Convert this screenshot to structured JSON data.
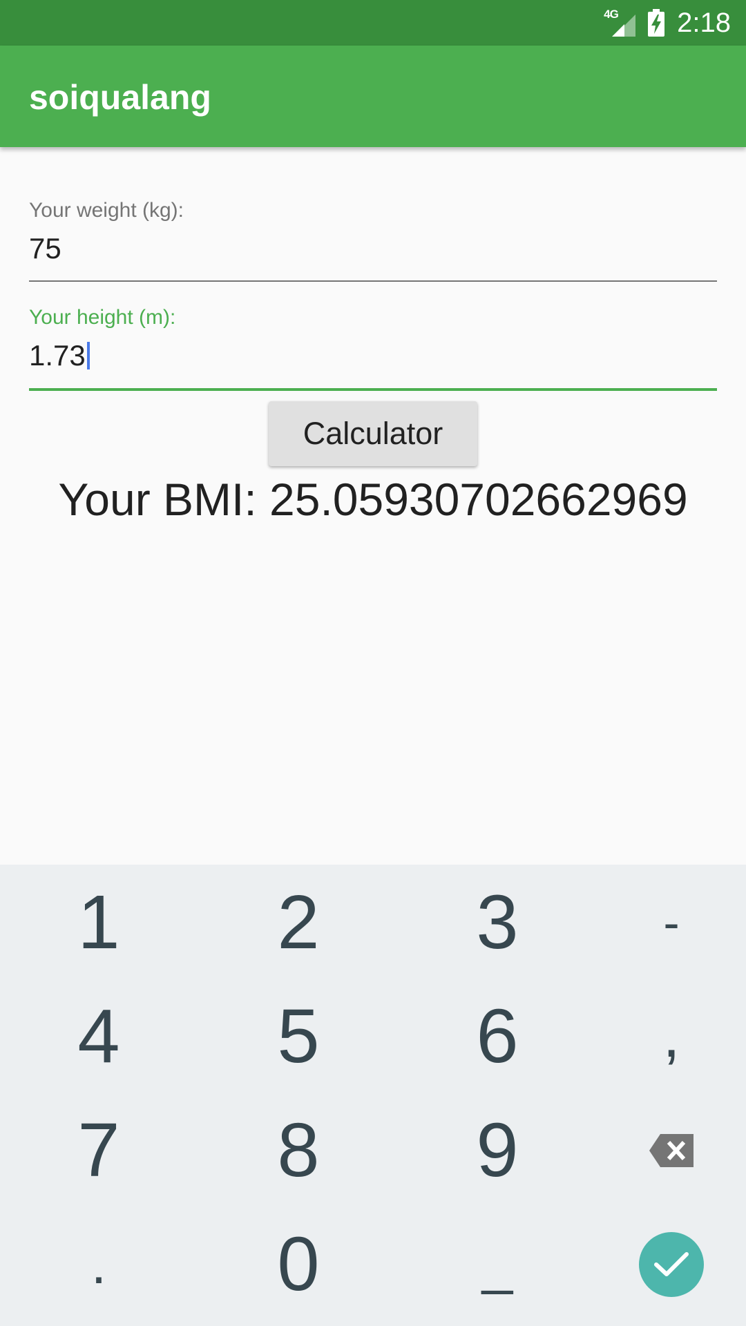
{
  "status_bar": {
    "network_label": "4G",
    "time": "2:18",
    "icons": [
      "signal-icon",
      "battery-charging-icon"
    ]
  },
  "app_bar": {
    "title": "soiqualang"
  },
  "form": {
    "weight": {
      "label": "Your weight (kg):",
      "value": "75"
    },
    "height": {
      "label": "Your height (m):",
      "value": "1.73"
    },
    "calculate_label": "Calculator",
    "result": "Your BMI: 25.05930702662969"
  },
  "keyboard": {
    "keys": [
      "1",
      "2",
      "3",
      "-",
      "4",
      "5",
      "6",
      ",",
      "7",
      "8",
      "9",
      ".",
      "0",
      "_"
    ],
    "icons": [
      "backspace-icon",
      "done-check-icon"
    ]
  },
  "colors": {
    "primary": "#4caf50",
    "primary_dark": "#388e3c",
    "keyboard_bg": "#eceff1",
    "key_text": "#37474f",
    "done_key": "#4db6ac",
    "cursor": "#4a7ae8"
  }
}
